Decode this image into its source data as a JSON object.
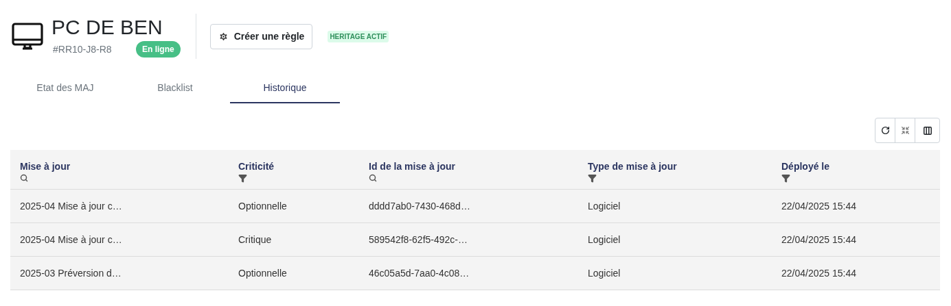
{
  "device": {
    "name": "PC DE BEN",
    "id": "#RR10-J8-R8",
    "status": "En ligne",
    "online": true
  },
  "rule_button": "Créer une règle",
  "inheritance_badge": "HERITAGE ACTIF",
  "tabs": [
    {
      "label": "Etat des MAJ",
      "selected": false
    },
    {
      "label": "Blacklist",
      "selected": false
    },
    {
      "label": "Historique",
      "selected": true
    }
  ],
  "table": {
    "columns": [
      {
        "label": "Mise à jour",
        "kind": "search"
      },
      {
        "label": "Criticité",
        "kind": "filter"
      },
      {
        "label": "Id de la mise à jour",
        "kind": "search"
      },
      {
        "label": "Type de mise à jour",
        "kind": "filter"
      },
      {
        "label": "Déployé le",
        "kind": "filter"
      }
    ],
    "rows": [
      [
        "2025-04 Mise à jour c…",
        "Optionnelle",
        "dddd7ab0-7430-468d…",
        "Logiciel",
        "22/04/2025 15:44"
      ],
      [
        "2025-04 Mise à jour c…",
        "Critique",
        "589542f8-62f5-492c-…",
        "Logiciel",
        "22/04/2025 15:44"
      ],
      [
        "2025-03 Préversion d…",
        "Optionnelle",
        "46c05a5d-7aa0-4c08…",
        "Logiciel",
        "22/04/2025 15:44"
      ]
    ]
  }
}
